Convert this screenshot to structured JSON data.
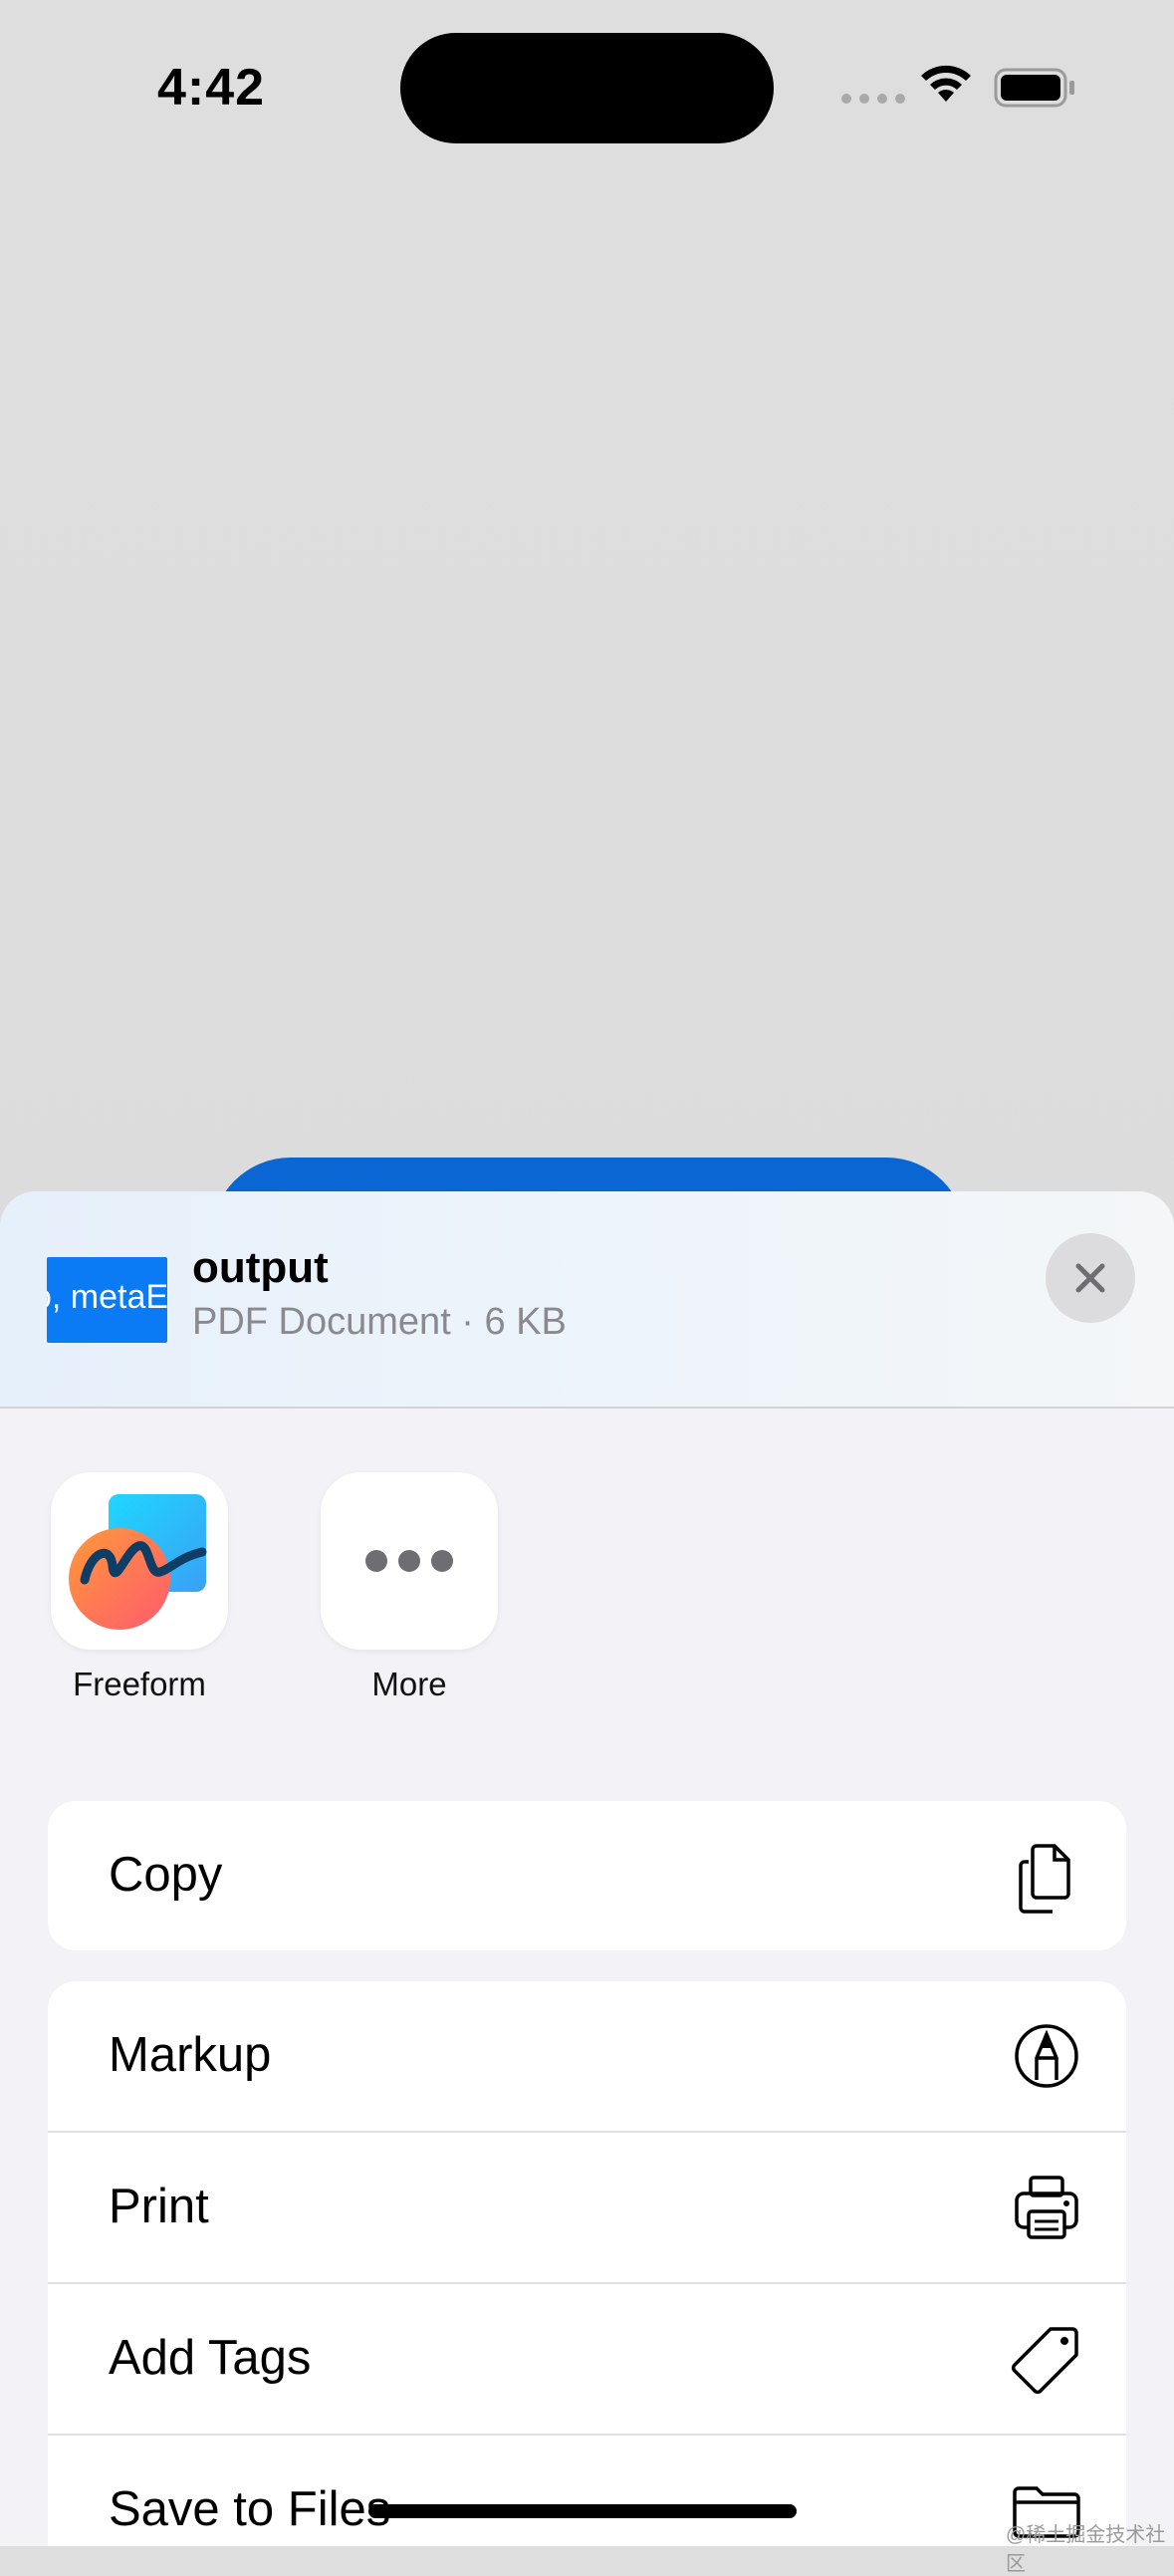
{
  "status_bar": {
    "time": "4:42"
  },
  "share_sheet": {
    "document": {
      "title": "output",
      "subtitle": "PDF Document · 6 KB",
      "thumbnail_text": "o, metaE"
    },
    "apps": [
      {
        "label": "Freeform",
        "icon": "freeform-icon"
      },
      {
        "label": "More",
        "icon": "more-dots-icon"
      }
    ],
    "actions_group1": [
      {
        "label": "Copy",
        "icon": "copy-icon"
      }
    ],
    "actions_group2": [
      {
        "label": "Markup",
        "icon": "markup-icon"
      },
      {
        "label": "Print",
        "icon": "print-icon"
      },
      {
        "label": "Add Tags",
        "icon": "tag-icon"
      },
      {
        "label": "Save to Files",
        "icon": "folder-icon"
      }
    ]
  },
  "watermark": "@稀土掘金技术社区",
  "colors": {
    "accent": "#0a7af5",
    "sheet_bg": "#f2f2f7"
  }
}
